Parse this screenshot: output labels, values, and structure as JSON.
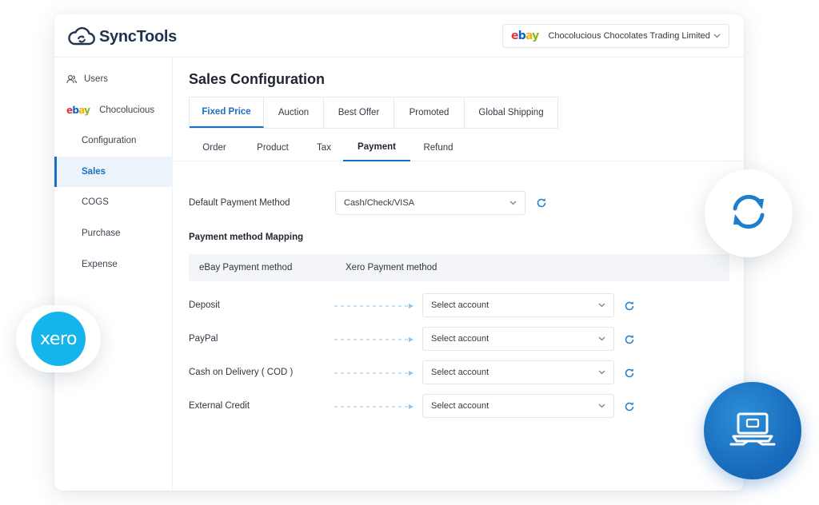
{
  "brand": {
    "name": "SyncTools"
  },
  "store_selector": {
    "marketplace": "ebay",
    "value": "Chocolucious Chocolates Trading Limited"
  },
  "sidebar": {
    "users_label": "Users",
    "store_label": "Chocolucious",
    "items": [
      {
        "label": "Configuration"
      },
      {
        "label": "Sales"
      },
      {
        "label": "COGS"
      },
      {
        "label": "Purchase"
      },
      {
        "label": "Expense"
      }
    ],
    "active": "Sales"
  },
  "page": {
    "title": "Sales Configuration"
  },
  "listing_tabs": [
    "Fixed Price",
    "Auction",
    "Best Offer",
    "Promoted",
    "Global Shipping"
  ],
  "listing_tab_active": "Fixed Price",
  "config_tabs": [
    "Order",
    "Product",
    "Tax",
    "Payment",
    "Refund"
  ],
  "config_tab_active": "Payment",
  "payment": {
    "default_label": "Default Payment Method",
    "default_value": "Cash/Check/VISA",
    "mapping_title": "Payment method Mapping",
    "col_ebay": "eBay Payment method",
    "col_xero": "Xero Payment method",
    "rows": [
      {
        "method": "Deposit",
        "account": "Select account"
      },
      {
        "method": "PayPal",
        "account": "Select account"
      },
      {
        "method": "Cash on Delivery ( COD )",
        "account": "Select account"
      },
      {
        "method": "External Credit",
        "account": "Select account"
      }
    ]
  },
  "badges": {
    "xero_text": "xero"
  },
  "colors": {
    "accent": "#1a6fc0",
    "xero": "#13b5ea",
    "sync_icon": "#1d7fd0"
  },
  "icons": [
    "cloud-sync-icon",
    "users-icon",
    "chevron-down-icon",
    "refresh-icon",
    "sync-icon",
    "laptop-hand-icon"
  ]
}
